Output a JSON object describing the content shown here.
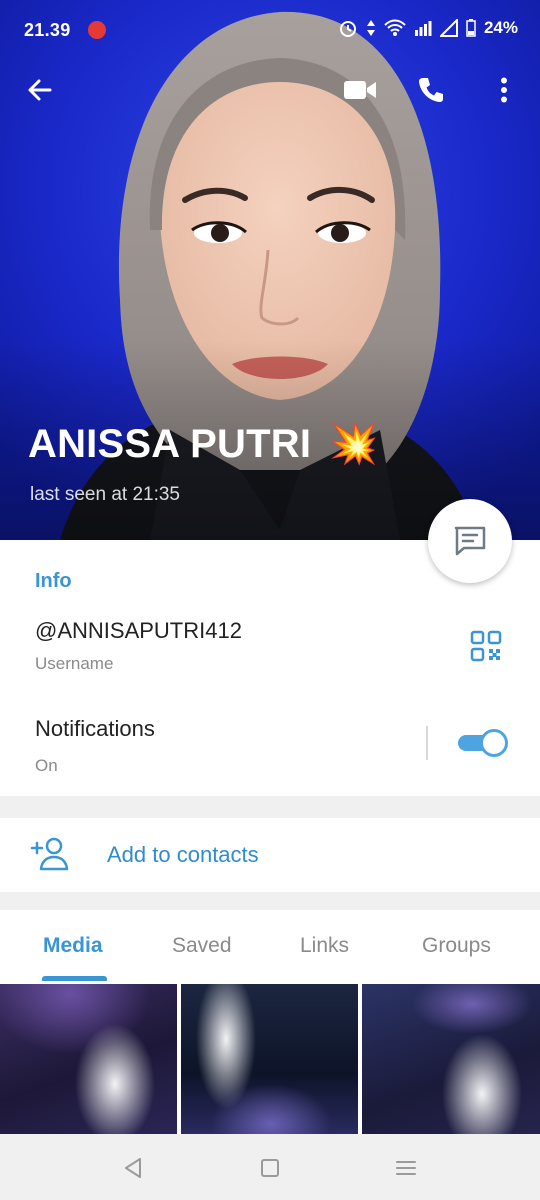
{
  "status_bar": {
    "time": "21.39",
    "battery": "24%"
  },
  "profile": {
    "name": "ANISSA PUTRI",
    "emoji": "💥",
    "last_seen": "last seen at 21:35"
  },
  "info": {
    "heading": "Info",
    "username": "@ANNISAPUTRI412",
    "username_label": "Username",
    "notifications_label": "Notifications",
    "notifications_value": "On",
    "notifications_enabled": true
  },
  "add_contacts": {
    "label": "Add to contacts"
  },
  "tabs": [
    {
      "label": "Media",
      "active": true
    },
    {
      "label": "Saved",
      "active": false
    },
    {
      "label": "Links",
      "active": false
    },
    {
      "label": "Groups",
      "active": false
    }
  ],
  "colors": {
    "accent": "#3a95d5",
    "header_bg": "#1a28c8"
  }
}
